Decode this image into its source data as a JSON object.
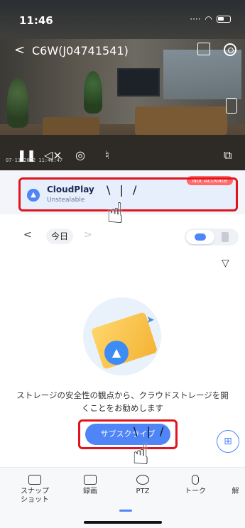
{
  "status_bar": {
    "time": "11:46"
  },
  "header": {
    "camera_title": "C6W(J04741541)"
  },
  "video": {
    "timestamp": "07-11-2022 11:46:47"
  },
  "cloud_banner": {
    "title": "CloudPlay",
    "subtitle": "Unstealable",
    "badge": "Not Activate"
  },
  "date_nav": {
    "date_label": "今日"
  },
  "empty_state": {
    "message": "ストレージの安全性の観点から、クラウドストレージを開くことをお勧めします",
    "subscribe_label": "サブスクライブ"
  },
  "toolbar": {
    "items": [
      {
        "label": "スナップ\nショット",
        "icon": "camera-icon"
      },
      {
        "label": "録画",
        "icon": "video-record-icon"
      },
      {
        "label": "PTZ",
        "icon": "ptz-icon"
      },
      {
        "label": "トーク",
        "icon": "microphone-icon"
      },
      {
        "label": "解",
        "icon": "resolution-icon"
      }
    ]
  },
  "colors": {
    "accent": "#4f85f7",
    "highlight": "#e0141d"
  }
}
